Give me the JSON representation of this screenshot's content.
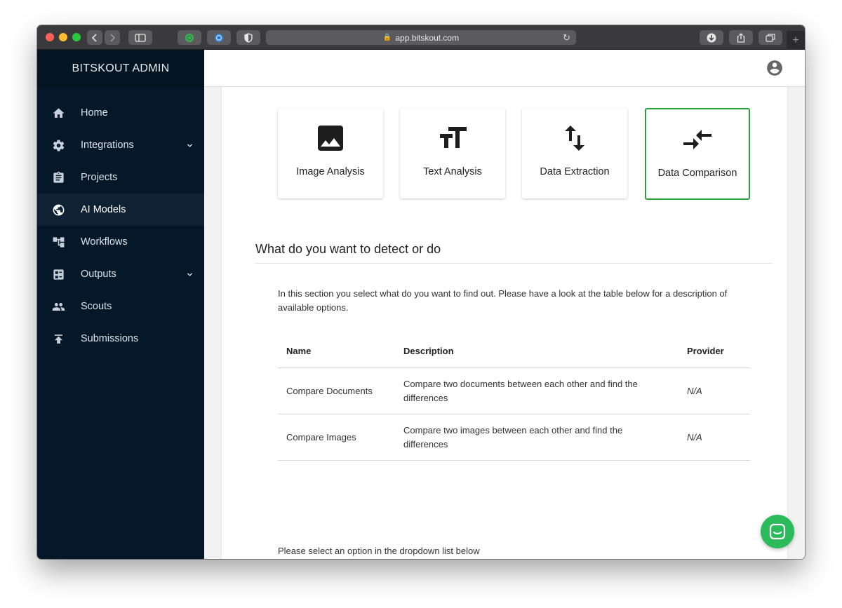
{
  "browser": {
    "url": "app.bitskout.com"
  },
  "sidebar": {
    "brand": "BITSKOUT ADMIN",
    "items": [
      {
        "label": "Home",
        "icon": "home-icon"
      },
      {
        "label": "Integrations",
        "icon": "gear-icon",
        "expandable": true
      },
      {
        "label": "Projects",
        "icon": "clipboard-icon"
      },
      {
        "label": "AI Models",
        "icon": "globe-icon",
        "active": true
      },
      {
        "label": "Workflows",
        "icon": "workflow-icon"
      },
      {
        "label": "Outputs",
        "icon": "outputs-icon",
        "expandable": true
      },
      {
        "label": "Scouts",
        "icon": "people-icon"
      },
      {
        "label": "Submissions",
        "icon": "upload-icon"
      }
    ]
  },
  "model_types": [
    {
      "label": "Image Analysis",
      "icon": "image-icon"
    },
    {
      "label": "Text Analysis",
      "icon": "text-size-icon"
    },
    {
      "label": "Data Extraction",
      "icon": "swap-vertical-icon"
    },
    {
      "label": "Data Comparison",
      "icon": "compare-arrows-icon",
      "selected": true
    }
  ],
  "section": {
    "title": "What do you want to detect or do",
    "intro": "In this section you select what do you want to find out. Please have a look at the table below for a description of available options."
  },
  "table": {
    "headers": [
      "Name",
      "Description",
      "Provider"
    ],
    "rows": [
      {
        "name": "Compare Documents",
        "description": "Compare two documents between each other and find the differences",
        "provider": "N/A"
      },
      {
        "name": "Compare Images",
        "description": "Compare two images between each other and find the differences",
        "provider": "N/A"
      }
    ]
  },
  "select": {
    "label": "Please select an option in the dropdown list below",
    "value": ""
  },
  "colors": {
    "sidebar_bg": "#051829",
    "selected_border": "#2aa43a",
    "chat_button": "#2bbb5b"
  }
}
